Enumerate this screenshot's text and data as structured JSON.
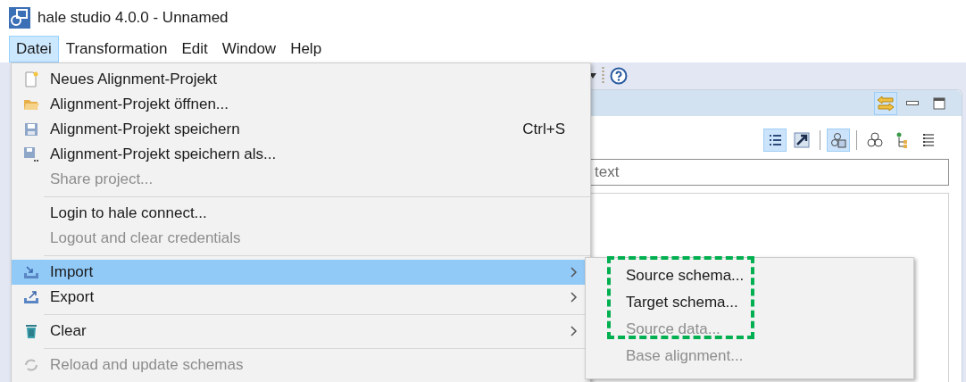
{
  "window": {
    "title": "hale studio 4.0.0 - Unnamed"
  },
  "menubar": [
    {
      "label": "Datei",
      "selected": true
    },
    {
      "label": "Transformation",
      "selected": false
    },
    {
      "label": "Edit",
      "selected": false
    },
    {
      "label": "Window",
      "selected": false
    },
    {
      "label": "Help",
      "selected": false
    }
  ],
  "file_menu": [
    {
      "kind": "item",
      "label": "Neues Alignment-Projekt",
      "disabled": false,
      "selected": false
    },
    {
      "kind": "item",
      "label": "Alignment-Projekt öffnen...",
      "disabled": false,
      "selected": false
    },
    {
      "kind": "item",
      "label": "Alignment-Projekt speichern",
      "shortcut": "Ctrl+S",
      "disabled": false,
      "selected": false
    },
    {
      "kind": "item",
      "label": "Alignment-Projekt speichern als...",
      "disabled": false,
      "selected": false
    },
    {
      "kind": "item",
      "label": "Share project...",
      "disabled": true,
      "selected": false
    },
    {
      "kind": "separator"
    },
    {
      "kind": "item",
      "label": "Login to hale connect...",
      "disabled": false,
      "selected": false
    },
    {
      "kind": "item",
      "label": "Logout and clear credentials",
      "disabled": true,
      "selected": false
    },
    {
      "kind": "separator"
    },
    {
      "kind": "submenu",
      "label": "Import",
      "disabled": false,
      "selected": true
    },
    {
      "kind": "submenu",
      "label": "Export",
      "disabled": false,
      "selected": false
    },
    {
      "kind": "separator"
    },
    {
      "kind": "submenu",
      "label": "Clear",
      "disabled": false,
      "selected": false
    },
    {
      "kind": "separator"
    },
    {
      "kind": "item",
      "label": "Reload and update schemas",
      "disabled": true,
      "selected": false
    }
  ],
  "import_submenu": [
    {
      "label": "Source schema...",
      "disabled": false
    },
    {
      "label": "Target schema...",
      "disabled": false
    },
    {
      "label": "Source data...",
      "disabled": true
    },
    {
      "label": "Base alignment...",
      "disabled": true
    }
  ],
  "panel": {
    "header_buttons": [
      {
        "selected": true
      },
      {
        "selected": false
      },
      {
        "selected": false
      }
    ],
    "view_buttons": [
      {
        "selected": true
      },
      {
        "selected": false
      },
      {
        "selected": true
      },
      {
        "selected": false
      },
      {
        "selected": false
      },
      {
        "selected": false
      }
    ],
    "filter": {
      "placeholder": "text"
    }
  }
}
